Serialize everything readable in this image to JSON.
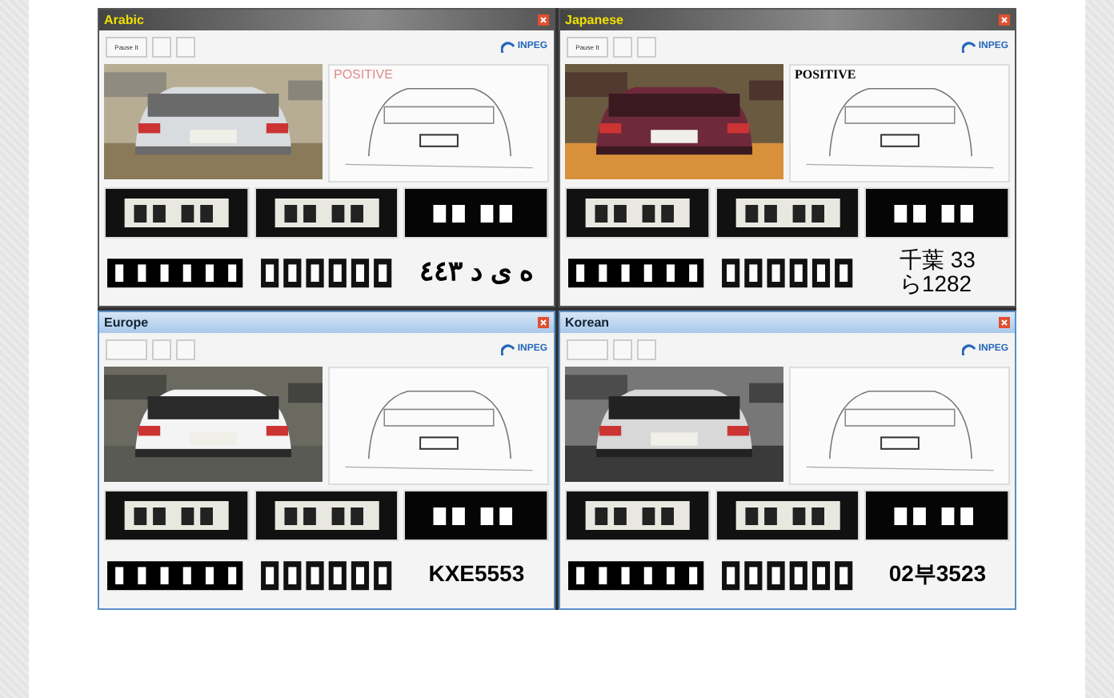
{
  "windows": [
    {
      "title": "Arabic",
      "kind": "dark",
      "pause_button": "Pause It",
      "logo": "INPEG",
      "edge_label": {
        "text": "POSITIVE",
        "kind": "red"
      },
      "result": {
        "kind": "arabic",
        "lines": [
          "٤٤٣ د ى ه"
        ]
      }
    },
    {
      "title": "Japanese",
      "kind": "dark",
      "pause_button": "Pause It",
      "logo": "INPEG",
      "edge_label": {
        "text": "POSITIVE",
        "kind": "serif"
      },
      "result": {
        "kind": "plain",
        "lines": [
          "千葉 33",
          "ら1282"
        ]
      }
    },
    {
      "title": "Europe",
      "kind": "light",
      "logo": "INPEG",
      "result": {
        "kind": "plain",
        "lines": [
          "KXE5553"
        ]
      }
    },
    {
      "title": "Korean",
      "kind": "light",
      "logo": "INPEG",
      "result": {
        "kind": "plain",
        "lines": [
          "02부3523"
        ]
      }
    }
  ]
}
